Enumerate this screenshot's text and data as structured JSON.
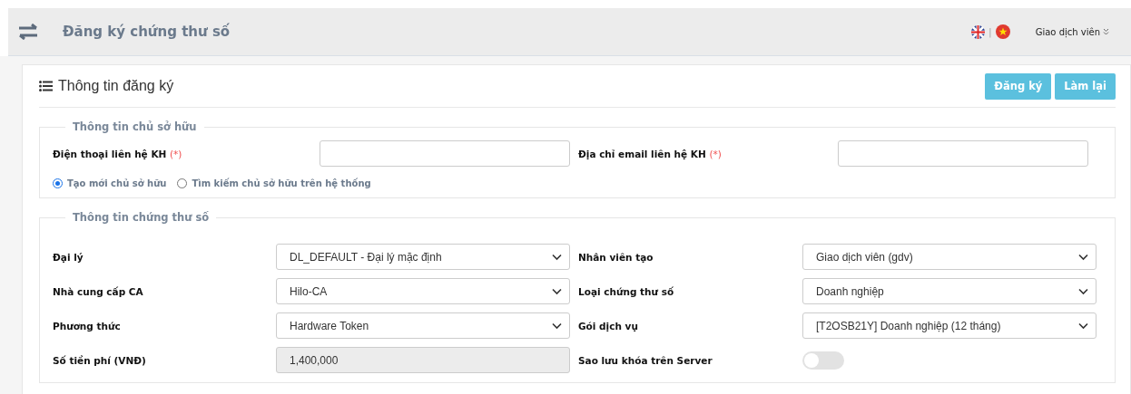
{
  "header": {
    "title": "Đăng ký chứng thư số",
    "user_menu": "Giao dịch viên",
    "language_separator": "|"
  },
  "card": {
    "title": "Thông tin đăng ký",
    "buttons": [
      "Đăng ký",
      "Làm lại"
    ]
  },
  "owner_section": {
    "legend": "Thông tin chủ sở hữu",
    "fields": [
      {
        "label": "Điện thoại liên hệ KH",
        "required_mark": "(*)",
        "kind": "text"
      },
      {
        "label": "Địa chỉ email liên hệ KH",
        "required_mark": "(*)",
        "kind": "text"
      }
    ],
    "owner_modes": [
      {
        "label": "Tạo mới chủ sở hữu",
        "selected": true
      },
      {
        "label": "Tìm kiếm chủ sở hữu trên hệ thống",
        "selected": false
      }
    ]
  },
  "certificate_section": {
    "legend": "Thông tin chứng thư số",
    "fields": [
      {
        "label": "Đại lý",
        "kind": "select",
        "value": "DL_DEFAULT - Đại lý mặc định"
      },
      {
        "label": "Nhân viên tạo",
        "kind": "select",
        "value": "Giao dịch viên (gdv)"
      },
      {
        "label": "Nhà cung cấp CA",
        "kind": "select",
        "value": "Hilo-CA"
      },
      {
        "label": "Loại chứng thư số",
        "kind": "select",
        "value": "Doanh nghiệp"
      },
      {
        "label": "Phương thức",
        "kind": "select",
        "value": "Hardware Token"
      },
      {
        "label": "Gói dịch vụ",
        "kind": "select",
        "value": "[T2OSB21Y] Doanh nghiệp (12 tháng)"
      },
      {
        "label": "Số tiền phí (VNĐ)",
        "kind": "readonly",
        "value": "1,400,000"
      },
      {
        "label": "Sao lưu khóa trên Server",
        "kind": "toggle",
        "on": false
      }
    ]
  }
}
